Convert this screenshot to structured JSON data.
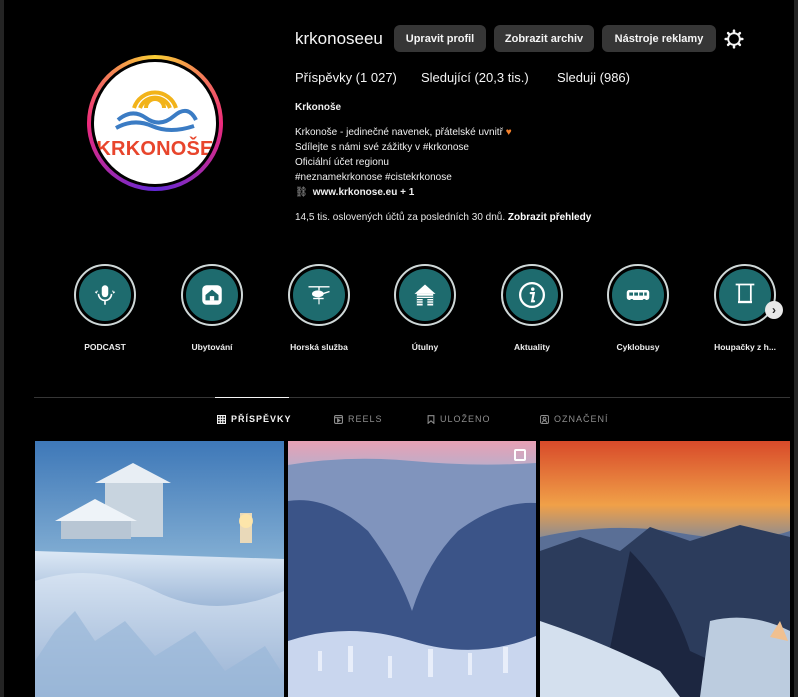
{
  "profile": {
    "username": "krkonoseeu",
    "avatar_logo_text": "KRKONOŠE",
    "buttons": {
      "edit": "Upravit profil",
      "archive": "Zobrazit archiv",
      "ads": "Nástroje reklamy"
    },
    "settings_icon": "gear-icon"
  },
  "stats": {
    "posts": "Příspěvky (1 027)",
    "followers": "Sledující (20,3 tis.)",
    "following": "Sleduji (986)"
  },
  "bio": {
    "name": "Krkonoše",
    "line1": "Krkonoše - jedinečné navenek, přátelské uvnitř",
    "heart": "♥",
    "line2": "Sdílejte s námi své zážitky v #krkonose",
    "line3": "Oficiální účet regionu",
    "line4": "#neznamekrkonose #cistekrkonose",
    "link_icon": "⛓",
    "link": "www.krkonose.eu + 1"
  },
  "reach": {
    "text": "14,5 tis. oslovených účtů za posledních 30 dnů.",
    "cta": "Zobrazit přehledy"
  },
  "highlights": [
    {
      "label": "PODCAST",
      "icon": "microphone-icon"
    },
    {
      "label": "Ubytování",
      "icon": "house-icon"
    },
    {
      "label": "Horská služba",
      "icon": "helicopter-icon"
    },
    {
      "label": "Útulny",
      "icon": "cabin-icon"
    },
    {
      "label": "Aktuality",
      "icon": "info-icon"
    },
    {
      "label": "Cyklobusy",
      "icon": "bus-icon"
    },
    {
      "label": "Houpačky z h...",
      "icon": "swing-icon"
    }
  ],
  "highlights_next": "›",
  "tabs": {
    "posts": "PŘÍSPĚVKY",
    "reels": "REELS",
    "saved": "ULOŽENO",
    "tagged": "OZNAČENÍ"
  }
}
